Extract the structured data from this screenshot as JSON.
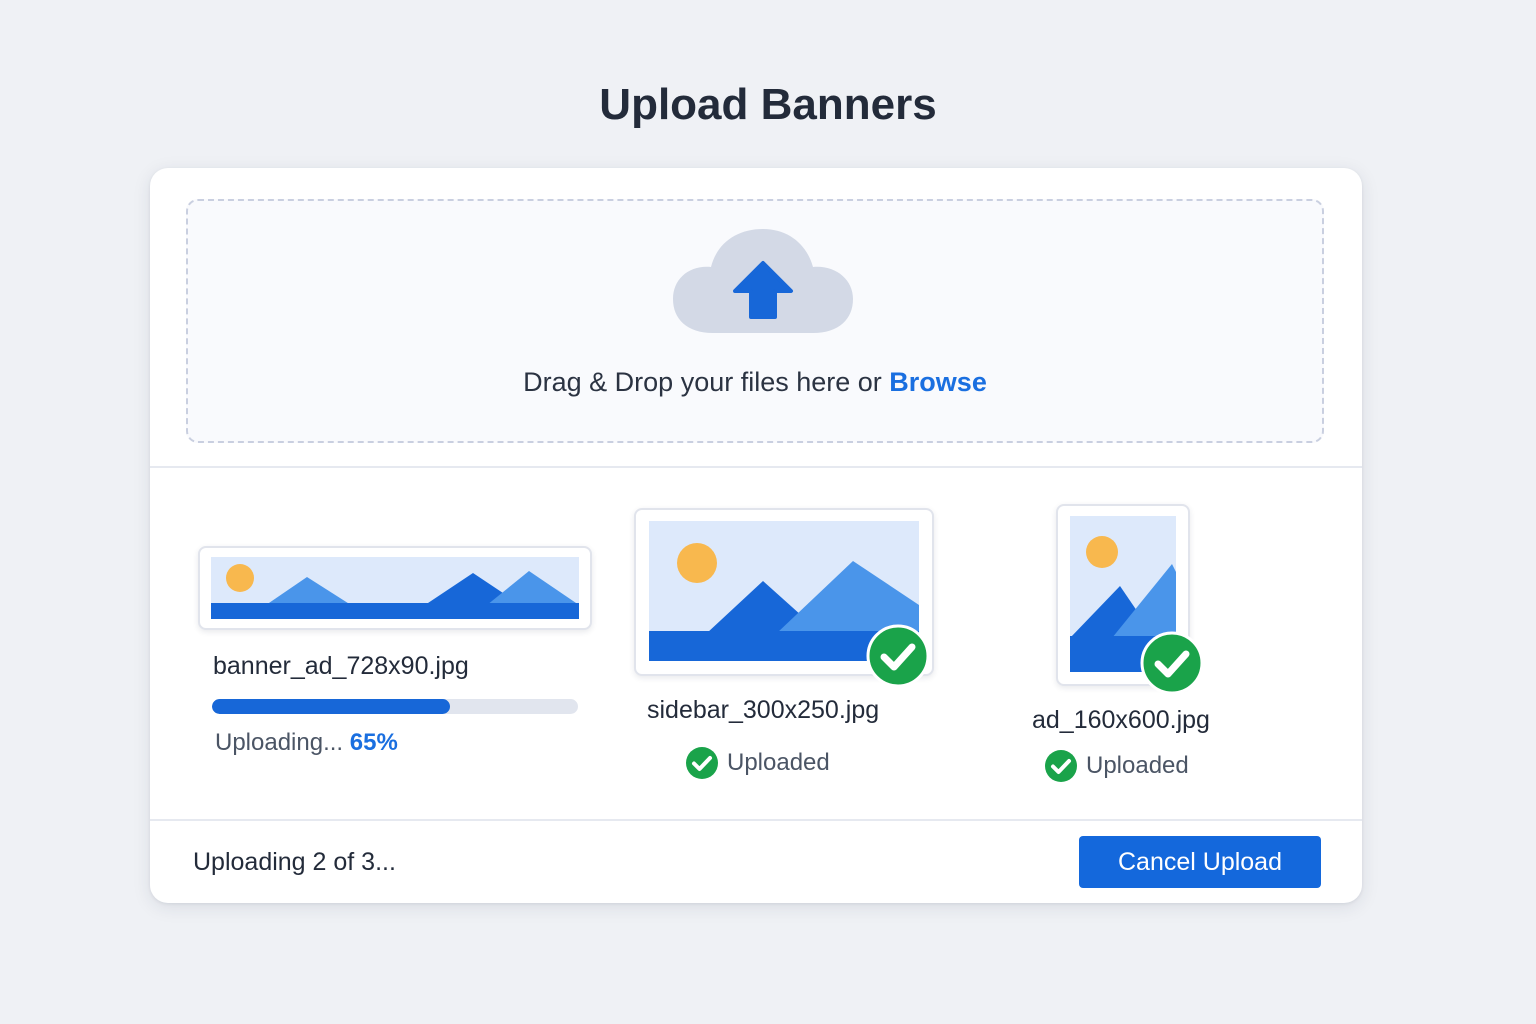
{
  "page": {
    "title": "Upload Banners"
  },
  "dropzone": {
    "icon": "cloud-upload-icon",
    "prompt": "Drag & Drop your files here or ",
    "browse_label": "Browse"
  },
  "files": [
    {
      "name": "banner_ad_728x90.jpg",
      "state": "uploading",
      "progress_label": "Uploading... ",
      "progress_percent_label": "65%",
      "progress": 0.65,
      "icon": "image-thumbnail-icon"
    },
    {
      "name": "sidebar_300x250.jpg",
      "state": "uploaded",
      "status_label": "Uploaded",
      "icon": "image-thumbnail-icon"
    },
    {
      "name": "ad_160x600.jpg",
      "state": "uploaded",
      "status_label": "Uploaded",
      "icon": "image-thumbnail-icon"
    }
  ],
  "footer": {
    "status": "Uploading 2 of 3...",
    "cancel_label": "Cancel Upload"
  },
  "colors": {
    "accent": "#1468dc",
    "success": "#1aa34a",
    "sun": "#f8b84e",
    "sky": "#dde9fb",
    "mountain_dark": "#1767d8",
    "mountain_light": "#4a95ea"
  }
}
